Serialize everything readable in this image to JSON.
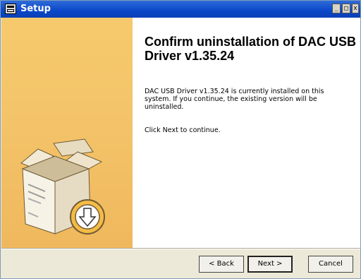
{
  "window": {
    "title": "Setup",
    "icons": {
      "system": "app-window-icon",
      "minimize": "minimize-icon",
      "maximize": "maximize-icon",
      "close": "close-icon"
    }
  },
  "sidebar": {
    "illustration": "installer-box-download-icon"
  },
  "main": {
    "heading": "Confirm uninstallation of DAC USB Driver v1.35.24",
    "description": "DAC USB Driver v1.35.24 is currently installed on this system. If you continue, the existing version will be uninstalled.",
    "instruction": "Click Next to continue."
  },
  "footer": {
    "back_label": "< Back",
    "next_label": "Next >",
    "cancel_label": "Cancel"
  }
}
